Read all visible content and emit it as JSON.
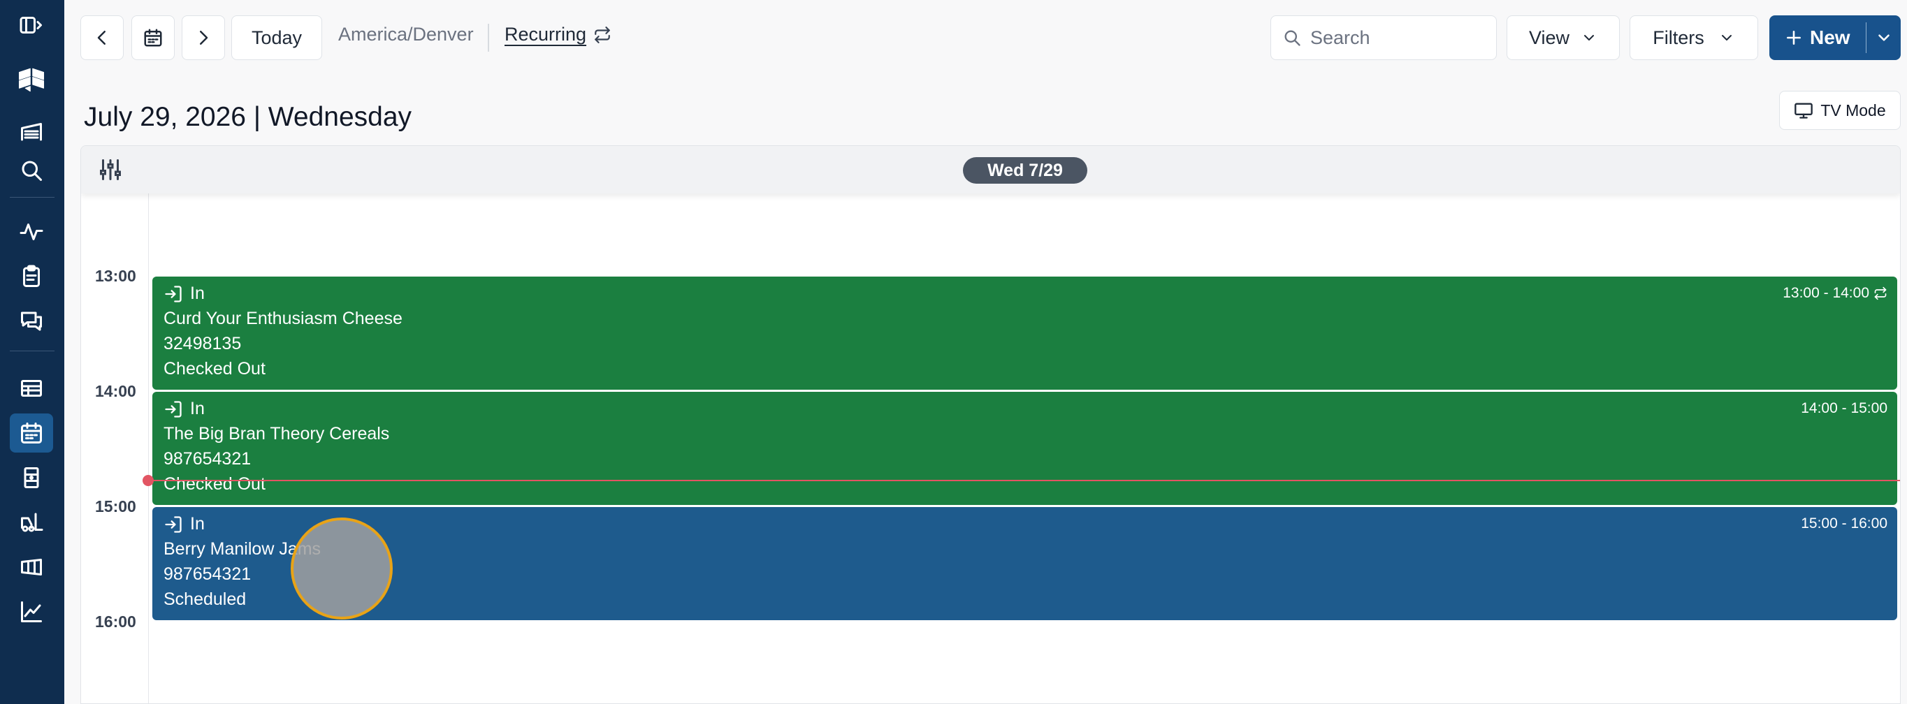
{
  "toolbar": {
    "today_label": "Today",
    "timezone": "America/Denver",
    "recurring_label": "Recurring",
    "search_placeholder": "Search",
    "view_label": "View",
    "filters_label": "Filters",
    "new_label": "New",
    "tv_mode_label": "TV Mode"
  },
  "sidebar": {
    "items": [
      {
        "icon": "sidebar-toggle-icon"
      },
      {
        "icon": "app-logo"
      },
      {
        "icon": "warehouse-icon"
      },
      {
        "icon": "search-icon"
      },
      {
        "icon": "activity-icon"
      },
      {
        "icon": "clipboard-icon"
      },
      {
        "icon": "messages-icon"
      },
      {
        "icon": "docks-icon"
      },
      {
        "icon": "calendar-icon",
        "active": true
      },
      {
        "icon": "door-icon"
      },
      {
        "icon": "forklift-icon"
      },
      {
        "icon": "ticket-icon"
      },
      {
        "icon": "analytics-icon"
      }
    ]
  },
  "header": {
    "date_title": "July 29, 2026 | Wednesday",
    "day_pill": "Wed 7/29"
  },
  "time_labels": [
    "13:00",
    "14:00",
    "15:00",
    "16:00"
  ],
  "events": [
    {
      "direction": "In",
      "name": "Curd Your Enthusiasm Cheese",
      "id": "32498135",
      "status": "Checked Out",
      "time": "13:00 - 14:00",
      "recurring": true,
      "color": "#1b7f40"
    },
    {
      "direction": "In",
      "name": "The Big Bran Theory Cereals",
      "id": "987654321",
      "status": "Checked Out",
      "time": "14:00 - 15:00",
      "recurring": false,
      "color": "#1b7f40"
    },
    {
      "direction": "In",
      "name": "Berry Manilow Jams",
      "id": "987654321",
      "status": "Scheduled",
      "time": "15:00 - 16:00",
      "recurring": false,
      "color": "#1e5b8d"
    }
  ],
  "colors": {
    "sidebar_bg": "#0f2d4f",
    "primary": "#18528c",
    "now_line": "#e25563",
    "checked_out": "#1b7f40",
    "scheduled": "#1e5b8d"
  }
}
